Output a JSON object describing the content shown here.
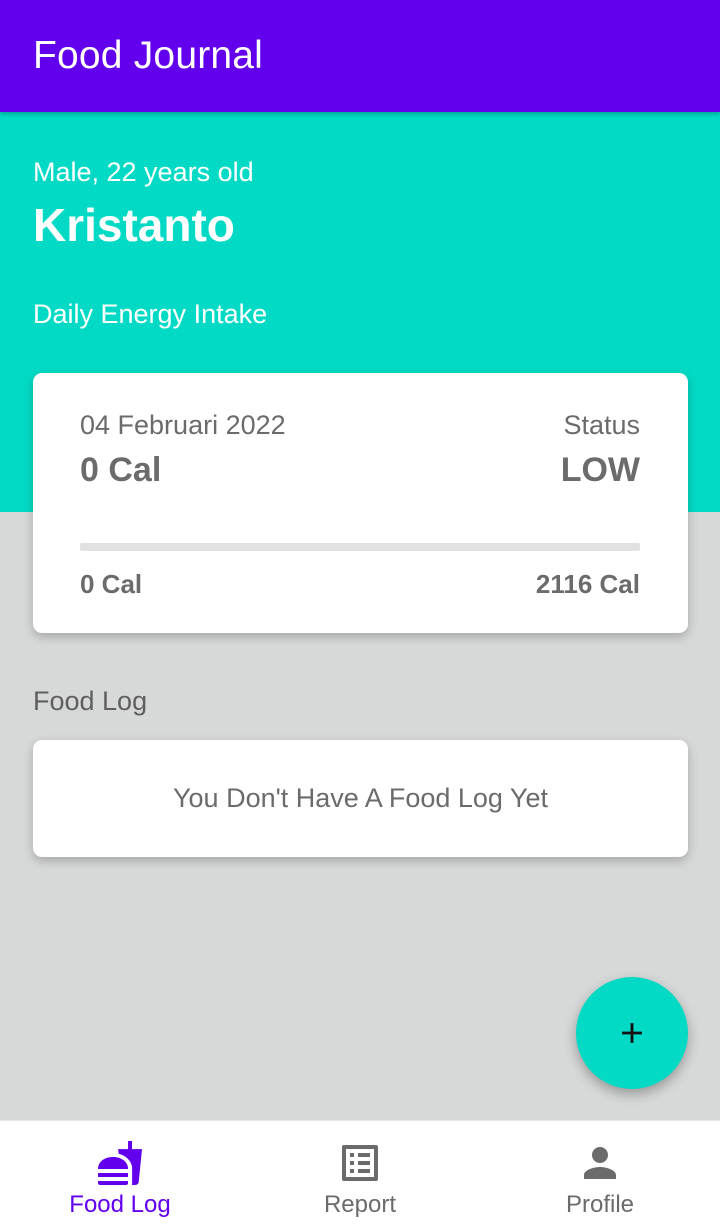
{
  "appbar": {
    "title": "Food Journal"
  },
  "profile": {
    "subtitle": "Male, 22 years old",
    "name": "Kristanto"
  },
  "energy": {
    "section_label": "Daily Energy Intake",
    "date": "04 Februari 2022",
    "calories": "0 Cal",
    "status_label": "Status",
    "status": "LOW",
    "progress_fraction": 0,
    "range_min": "0 Cal",
    "range_max": "2116 Cal"
  },
  "food_log": {
    "section_label": "Food Log",
    "empty_message": "You Don't Have A Food Log Yet"
  },
  "fab": {
    "icon": "plus-icon"
  },
  "bottom_nav": {
    "items": [
      {
        "label": "Food Log",
        "icon": "fastfood-icon",
        "active": true
      },
      {
        "label": "Report",
        "icon": "report-list-icon",
        "active": false
      },
      {
        "label": "Profile",
        "icon": "person-icon",
        "active": false
      }
    ]
  },
  "colors": {
    "primary": "#6200ee",
    "accent": "#03dac5",
    "background": "#d7d8d8",
    "text_muted": "#6b6b6b"
  }
}
